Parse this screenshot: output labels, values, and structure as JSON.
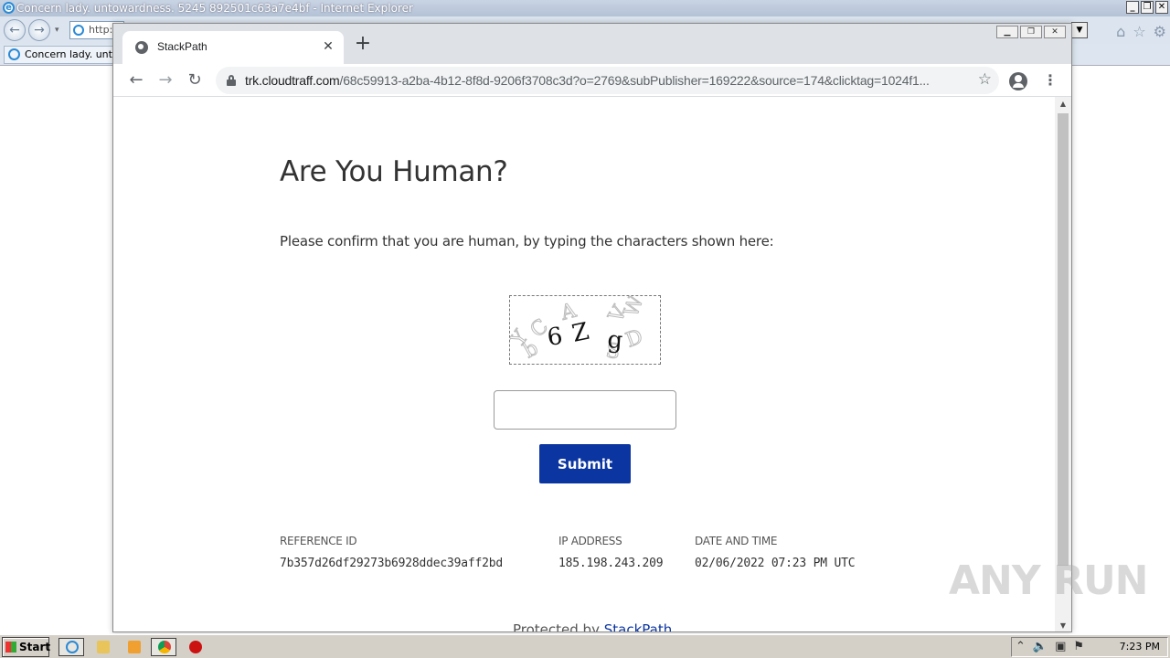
{
  "ie": {
    "window_title": "Concern lady. untowardness. 5245 892501c63a7e4bf - Internet Explorer",
    "address_text": "http:",
    "tab_title": "Concern lady. untow"
  },
  "chrome": {
    "tab_title": "StackPath",
    "url_host": "trk.cloudtraff.com",
    "url_rest": "/68c59913-a2ba-4b12-8f8d-9206f3708c3d?o=2769&subPublisher=169222&source=174&clicktag=1024f1..."
  },
  "page": {
    "title": "Are You Human?",
    "instruction": "Please confirm that you are human, by typing the characters shown here:",
    "captcha": {
      "main_chars": [
        "6",
        "Z",
        "g"
      ],
      "noise_chars": [
        "Y",
        "C",
        "A",
        "V",
        "W",
        "D",
        "b",
        "S"
      ]
    },
    "input_value": "",
    "submit_label": "Submit",
    "reference_label": "REFERENCE ID",
    "reference_value": "7b357d26df29273b6928ddec39aff2bd",
    "ip_label": "IP ADDRESS",
    "ip_value": "185.198.243.209",
    "date_label": "DATE AND TIME",
    "date_value": "02/06/2022 07:23 PM UTC",
    "protected_prefix": "Protected by",
    "protected_link": "StackPath"
  },
  "watermark": "ANY RUN",
  "taskbar": {
    "start_label": "Start",
    "clock": "7:23 PM"
  },
  "colors": {
    "submit_bg": "#0b35a0",
    "link": "#0b35a0"
  },
  "icons": [
    "ie-logo-icon",
    "back-icon",
    "forward-icon",
    "reload-icon",
    "lock-icon",
    "star-icon",
    "profile-icon",
    "menu-icon",
    "globe-icon",
    "close-icon",
    "plus-icon",
    "home-icon",
    "gear-icon"
  ]
}
